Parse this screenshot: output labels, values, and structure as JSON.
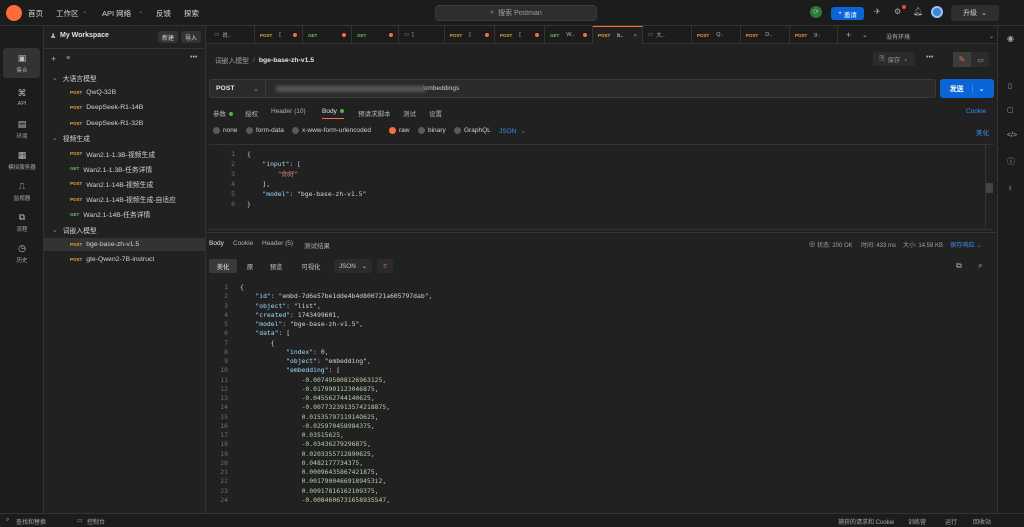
{
  "topbar": {
    "nav": [
      "首页",
      "工作区",
      "API 网络",
      "反馈",
      "探索"
    ],
    "search_placeholder": "搜索 Postman",
    "invite": "邀请",
    "upgrade": "升级"
  },
  "rail": [
    {
      "label": "集合"
    },
    {
      "label": "API"
    },
    {
      "label": "环境"
    },
    {
      "label": "模拟服务器"
    },
    {
      "label": "监视器"
    },
    {
      "label": "流程"
    },
    {
      "label": "历史"
    }
  ],
  "sidebar": {
    "workspace": "My Workspace",
    "new_label": "新建",
    "import_label": "导入",
    "tree": [
      {
        "type": "folder",
        "label": "大语言模型",
        "indent": 0
      },
      {
        "type": "req",
        "method": "POST",
        "label": "QwQ-32B",
        "indent": 1
      },
      {
        "type": "req",
        "method": "POST",
        "label": "DeepSeek-R1-14B",
        "indent": 1
      },
      {
        "type": "req",
        "method": "POST",
        "label": "DeepSeek-R1-32B",
        "indent": 1
      },
      {
        "type": "folder",
        "label": "视频生成",
        "indent": 0
      },
      {
        "type": "req",
        "method": "POST",
        "label": "Wan2.1-1.3B-视频生成",
        "indent": 1
      },
      {
        "type": "req",
        "method": "GET",
        "label": "Wan2.1-1.3B-任务详情",
        "indent": 1
      },
      {
        "type": "req",
        "method": "POST",
        "label": "Wan2.1-14B-视频生成",
        "indent": 1
      },
      {
        "type": "req",
        "method": "POST",
        "label": "Wan2.1-14B-视频生成-自适应",
        "indent": 1
      },
      {
        "type": "req",
        "method": "GET",
        "label": "Wan2.1-14B-任务详情",
        "indent": 1
      },
      {
        "type": "folder",
        "label": "词嵌入模型",
        "indent": 0
      },
      {
        "type": "req",
        "method": "POST",
        "label": "bge-base-zh-v1.5",
        "indent": 1,
        "active": true
      },
      {
        "type": "req",
        "method": "POST",
        "label": "gte-Qwen2-7B-instruct",
        "indent": 1
      }
    ]
  },
  "tabs": [
    {
      "method": "",
      "label": "说.."
    },
    {
      "method": "POST",
      "label": "[",
      "dot": true
    },
    {
      "method": "GET",
      "label": "",
      "dot": true
    },
    {
      "method": "GET",
      "label": "",
      "dot": true
    },
    {
      "method": "",
      "label": "[",
      "dot": false
    },
    {
      "method": "POST",
      "label": "[",
      "dot": true
    },
    {
      "method": "POST",
      "label": "[",
      "dot": true
    },
    {
      "method": "GET",
      "label": "W..",
      "dot": true
    },
    {
      "method": "POST",
      "label": "b..",
      "active": true
    },
    {
      "method": "",
      "label": "大.."
    },
    {
      "method": "POST",
      "label": "Q.."
    },
    {
      "method": "POST",
      "label": "D.."
    },
    {
      "method": "POST",
      "label": "g.."
    }
  ],
  "env": "没有环境",
  "breadcrumb": {
    "parent": "词嵌入模型",
    "sep": "/",
    "current": "bge-base-zh-v1.5"
  },
  "save_label": "保存",
  "request": {
    "method": "POST",
    "url": "https://...../embeddings",
    "send": "发送"
  },
  "req_tabs": [
    "参数",
    "授权",
    "Header (10)",
    "Body",
    "预请求脚本",
    "测试",
    "设置"
  ],
  "cookie_label": "Cookie",
  "beautify_label": "美化",
  "body_types": [
    "none",
    "form-data",
    "x-www-form-urlencoded",
    "raw",
    "binary",
    "GraphQL"
  ],
  "body_format": "JSON",
  "request_body": [
    "{",
    "    \"input\": [",
    "        \"你好\"",
    "    ],",
    "    \"model\": \"bge-base-zh-v1.5\"",
    "}"
  ],
  "response": {
    "tabs": [
      "Body",
      "Cookie",
      "Header (5)",
      "测试结果"
    ],
    "status": "状态: 200 OK",
    "time": "时间: 433 ms",
    "size": "大小: 14.58 KB",
    "save": "保存响应",
    "format_tabs": [
      "美化",
      "原",
      "预览",
      "可视化"
    ],
    "format": "JSON",
    "lines": [
      "{",
      "    \"id\": \"embd-7d6e57be1dde4b4d800721a605797dab\",",
      "    \"object\": \"list\",",
      "    \"created\": 1743499601,",
      "    \"model\": \"bge-base-zh-v1.5\",",
      "    \"data\": [",
      "        {",
      "            \"index\": 0,",
      "            \"object\": \"embedding\",",
      "            \"embedding\": [",
      "                -0.007495808126963125,",
      "                -0.0179901123046875,",
      "                -0.045562744140625,",
      "                -0.0077323913574218875,",
      "                0.0153579711914O625,",
      "                -0.025970458984375,",
      "                0.03515625,",
      "                -0.03436279296875,",
      "                0.0203355712890625,",
      "                0.0482177734375,",
      "                0.00096435867421875,",
      "                0.00179004669189453i2,",
      "                0.00917816162109375,",
      "                -0.0084606731658935547,"
    ]
  },
  "statusbar": {
    "left1": "查找和替换",
    "left2": "控制台",
    "right": [
      "捕获的请求和 Cookie",
      "训练营",
      "运行",
      "回收站"
    ]
  }
}
